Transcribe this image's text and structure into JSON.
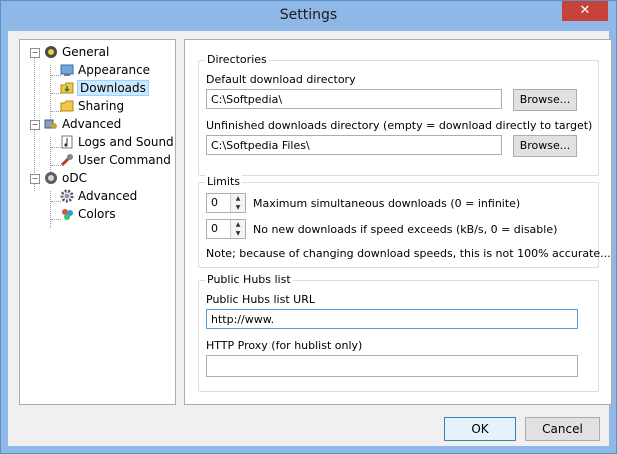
{
  "window": {
    "title": "Settings",
    "close_glyph": "✕"
  },
  "tree": {
    "items": [
      {
        "label": "General",
        "icon": "general-icon"
      },
      {
        "label": "Appearance",
        "icon": "appearance-icon"
      },
      {
        "label": "Downloads",
        "icon": "downloads-folder-icon",
        "selected": true
      },
      {
        "label": "Sharing",
        "icon": "sharing-folder-icon"
      },
      {
        "label": "Advanced",
        "icon": "advanced-icon"
      },
      {
        "label": "Logs and Sound",
        "icon": "logs-icon"
      },
      {
        "label": "User Command",
        "icon": "user-command-icon"
      },
      {
        "label": "oDC",
        "icon": "odc-icon"
      },
      {
        "label": "Advanced",
        "icon": "gear-icon"
      },
      {
        "label": "Colors",
        "icon": "colors-icon"
      }
    ],
    "expander_glyph": "−"
  },
  "directories": {
    "title": "Directories",
    "default_label": "Default download directory",
    "default_value": "C:\\Softpedia\\",
    "unfinished_label": "Unfinished downloads directory (empty = download directly to target)",
    "unfinished_value": "C:\\Softpedia Files\\",
    "browse_label": "Browse..."
  },
  "limits": {
    "title": "Limits",
    "max_sim_value": "0",
    "max_sim_label": "Maximum simultaneous downloads (0 = infinite)",
    "no_new_value": "0",
    "no_new_label": "No new downloads if speed exceeds (kB/s, 0 = disable)",
    "note": "Note; because of changing download speeds, this is not 100% accurate..."
  },
  "hubs": {
    "title": "Public Hubs list",
    "url_label": "Public Hubs list URL",
    "url_value": "http://www.",
    "proxy_label": "HTTP Proxy (for hublist only)",
    "proxy_value": ""
  },
  "footer": {
    "ok_label": "OK",
    "cancel_label": "Cancel"
  },
  "colors": {
    "titlebar": "#8fb8e6",
    "close": "#c7433a",
    "selection": "#cce8ff",
    "focus": "#569de5"
  }
}
